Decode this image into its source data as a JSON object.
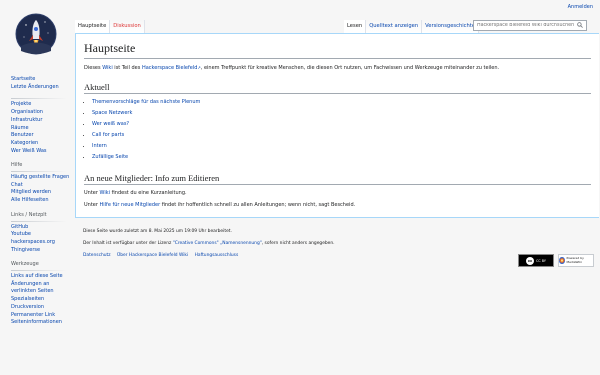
{
  "personal": {
    "login": "Anmelden"
  },
  "tabs_left": [
    {
      "label": "Hauptseite",
      "selected": true,
      "red": false
    },
    {
      "label": "Diskussion",
      "selected": false,
      "red": true
    }
  ],
  "tabs_right": [
    {
      "label": "Lesen",
      "selected": true
    },
    {
      "label": "Quelltext anzeigen",
      "selected": false
    },
    {
      "label": "Versionsgeschichte",
      "selected": false
    }
  ],
  "search": {
    "placeholder": "Hackerspace Bielefeld Wiki durchsuchen"
  },
  "sidebar": {
    "main": [
      "Startseite",
      "Letzte Änderungen"
    ],
    "sections": [
      {
        "heading": "",
        "items": [
          "Projekte",
          "Organisation",
          "Infrastruktur",
          "Räume",
          "Benutzer",
          "Kategorien",
          "Wer Weiß Was"
        ]
      },
      {
        "heading": "Hilfe",
        "items": [
          "Häufig gestellte Fragen",
          "Chat",
          "Mitglied werden",
          "Alle Hilfeseiten"
        ]
      },
      {
        "heading": "Links / Netzplt",
        "items": [
          "GitHub",
          "Youtube",
          "hackerspaces.org",
          "Thingiverse"
        ]
      },
      {
        "heading": "Werkzeuge",
        "items": [
          "Links auf diese Seite",
          "Änderungen an verlinkten Seiten",
          "Spezialseiten",
          "Druckversion",
          "Permanenter Link",
          "Seiteninformationen"
        ]
      }
    ]
  },
  "content": {
    "title": "Hauptseite",
    "intro": {
      "pre": "Dieses ",
      "link1": "Wiki",
      "mid": " ist Teil des ",
      "link2": "Hackerspace Bielefeld",
      "post": ", einem Treffpunkt für kreative Menschen, die diesen Ort nutzen, um Fachwissen und Werkzeuge miteinander zu teilen."
    },
    "aktuell_heading": "Aktuell",
    "aktuell_items": [
      "Themenvorschläge für das nächste Plenum",
      "Space Netzwerk",
      "Wer weiß was?",
      "Call for parts",
      "Intern",
      "Zufällige Seite"
    ],
    "neue_heading": "An neue Mitglieder: Info zum Editieren",
    "neue_p1": {
      "pre": "Unter ",
      "link": "Wiki",
      "post": " findest du eine Kurzanleitung."
    },
    "neue_p2": {
      "pre": "Unter ",
      "link": "Hilfe für neue Mitglieder",
      "post": " findet ihr hoffentlich schnell zu allen Anleitungen; wenn nicht, sagt Bescheid."
    }
  },
  "footer": {
    "lastmod": "Diese Seite wurde zuletzt am 8. Mai 2025 um 19:09 Uhr bearbeitet.",
    "license": {
      "pre": "Der Inhalt ist verfügbar unter der Lizenz ",
      "link": "\"Creative Commons\" „Namensnennung\"",
      "post": ", sofern nicht anders angegeben."
    },
    "links": [
      "Datenschutz",
      "Über Hackerspace Bielefeld Wiki",
      "Haftungsausschluss"
    ],
    "badges": [
      "CC BY",
      "Powered by MediaWiki"
    ]
  }
}
